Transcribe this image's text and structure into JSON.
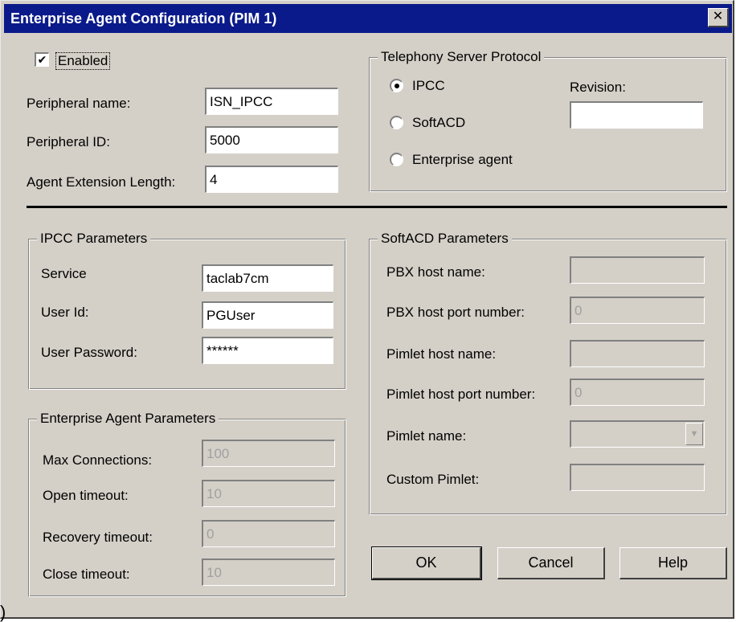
{
  "window": {
    "title": "Enterprise Agent Configuration (PIM 1)",
    "close": "✕"
  },
  "enabled": {
    "label": "Enabled",
    "checked": true,
    "check": "✔"
  },
  "peripheral": {
    "name_label": "Peripheral name:",
    "name_value": "ISN_IPCC",
    "id_label": "Peripheral ID:",
    "id_value": "5000",
    "ext_label": "Agent Extension Length:",
    "ext_value": "4"
  },
  "protocol": {
    "title": "Telephony Server Protocol",
    "options": [
      "IPCC",
      "SoftACD",
      "Enterprise agent"
    ],
    "selected": "IPCC",
    "revision_label": "Revision:",
    "revision_value": ""
  },
  "ipcc": {
    "title": "IPCC Parameters",
    "service_label": "Service",
    "service_value": "taclab7cm",
    "userid_label": "User Id:",
    "userid_value": "PGUser",
    "password_label": "User Password:",
    "password_value": "******"
  },
  "ea": {
    "title": "Enterprise Agent Parameters",
    "max_label": "Max Connections:",
    "max_value": "100",
    "open_label": "Open timeout:",
    "open_value": "10",
    "recovery_label": "Recovery timeout:",
    "recovery_value": "0",
    "close_label": "Close timeout:",
    "close_value": "10"
  },
  "softacd": {
    "title": "SoftACD Parameters",
    "pbx_host_label": "PBX host name:",
    "pbx_host_value": "",
    "pbx_port_label": "PBX host port number:",
    "pbx_port_value": "0",
    "pimlet_host_label": "Pimlet host name:",
    "pimlet_host_value": "",
    "pimlet_port_label": "Pimlet host port number:",
    "pimlet_port_value": "0",
    "pimlet_name_label": "Pimlet name:",
    "pimlet_name_value": "",
    "custom_label": "Custom Pimlet:",
    "custom_value": "",
    "arrow": "▼"
  },
  "buttons": {
    "ok": "OK",
    "cancel": "Cancel",
    "help": "Help"
  },
  "stray_glyph": ")"
}
